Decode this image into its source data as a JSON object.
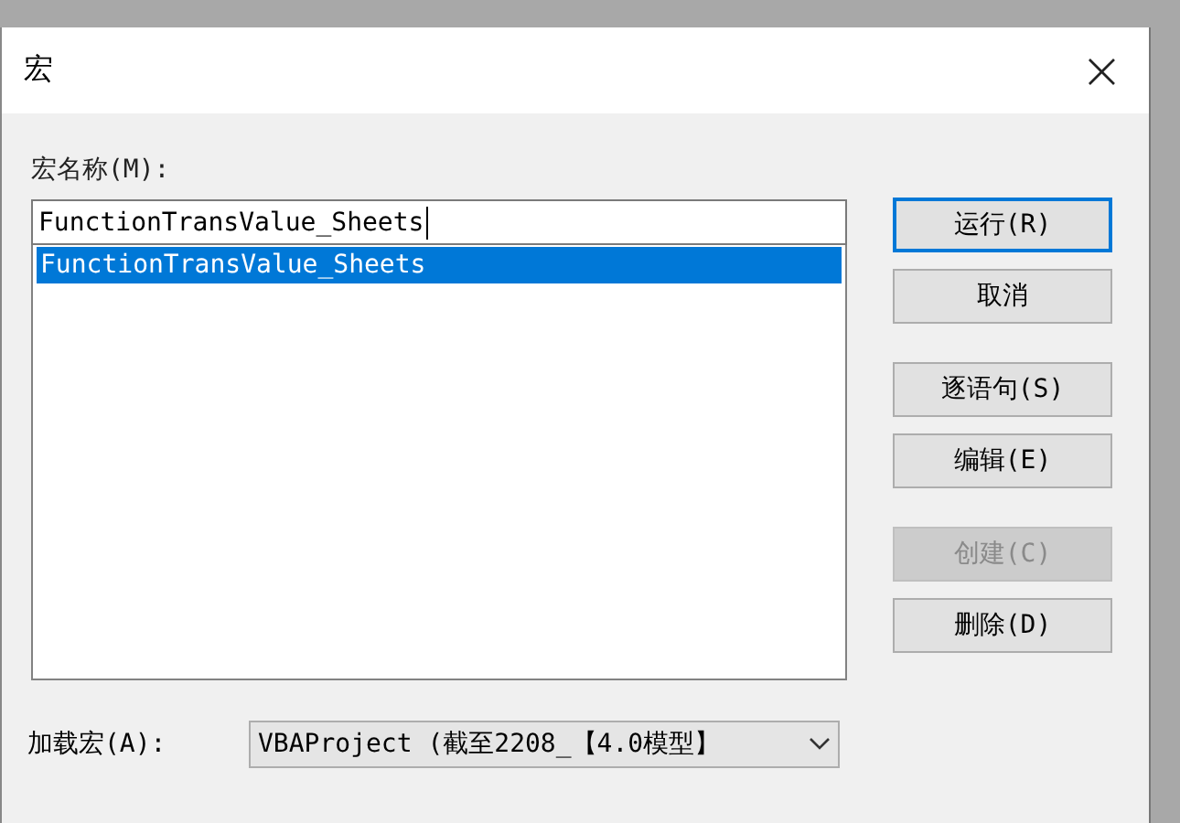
{
  "window": {
    "title": "宏",
    "close": "×"
  },
  "name_label": "宏名称(M):",
  "name_field": {
    "value": "FunctionTransValue_Sheets"
  },
  "macro_list": [
    {
      "label": "FunctionTransValue_Sheets",
      "selected": true
    }
  ],
  "button_groups": [
    [
      {
        "label": "运行(R)",
        "default": true,
        "disabled": false
      },
      {
        "label": "取消",
        "default": false,
        "disabled": false
      }
    ],
    [
      {
        "label": "逐语句(S)",
        "default": false,
        "disabled": false
      },
      {
        "label": "编辑(E)",
        "default": false,
        "disabled": false
      }
    ],
    [
      {
        "label": "创建(C)",
        "default": false,
        "disabled": true
      },
      {
        "label": "删除(D)",
        "default": false,
        "disabled": false
      }
    ]
  ],
  "macros_in_label": "加载宏(A):",
  "macros_in_select": {
    "value": "VBAProject (截至2208_【4.0模型】"
  }
}
